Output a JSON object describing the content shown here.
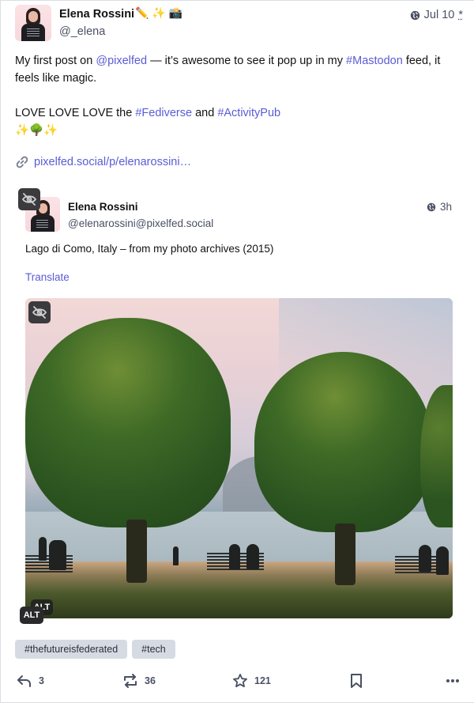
{
  "post": {
    "author": {
      "display_name": "Elena Rossini",
      "name_emoji": "✏️ ✨ 📸",
      "handle": "@_elena",
      "avatar": "avatar-photo"
    },
    "visibility_icon": "globe-icon",
    "timestamp": "Jul 10",
    "edited_marker": "*",
    "content": {
      "para1": {
        "t1": "My first post on ",
        "mention": "@pixelfed",
        "t2": " — it’s awesome to see it pop up in my ",
        "hashtag": "#Mastodon",
        "t3": " feed, it feels like magic."
      },
      "para2": {
        "t1": "LOVE LOVE LOVE the ",
        "hashtag1": "#Fediverse",
        "t2": " and ",
        "hashtag2": "#ActivityPub",
        "emoji": "✨🌳✨"
      },
      "link_icon": "link-icon",
      "link": "pixelfed.social/p/elenarossini…"
    },
    "quote": {
      "hide_icon": "eye-slash-icon",
      "author": {
        "display_name": "Elena Rossini",
        "handle": "@elenarossini@pixelfed.social"
      },
      "visibility_icon": "globe-icon",
      "timestamp": "3h",
      "text": "Lago di Como, Italy – from my photo archives (2015)",
      "translate_label": "Translate",
      "media": {
        "description": "Two round-trimmed trees on a lakeside promenade with benches and people, Lake Como",
        "hide_icon": "eye-slash-icon",
        "alt_badge": "ALT"
      }
    },
    "alt_badge": "ALT",
    "tags": [
      "#thefutureisfederated",
      "#tech"
    ],
    "actions": {
      "reply_count": "3",
      "boost_count": "36",
      "favourite_count": "121"
    },
    "colors": {
      "link": "#5b5bd6",
      "muted_text": "#4a5064",
      "tag_bg": "#d6dbe3",
      "border": "#d9dde4"
    }
  }
}
